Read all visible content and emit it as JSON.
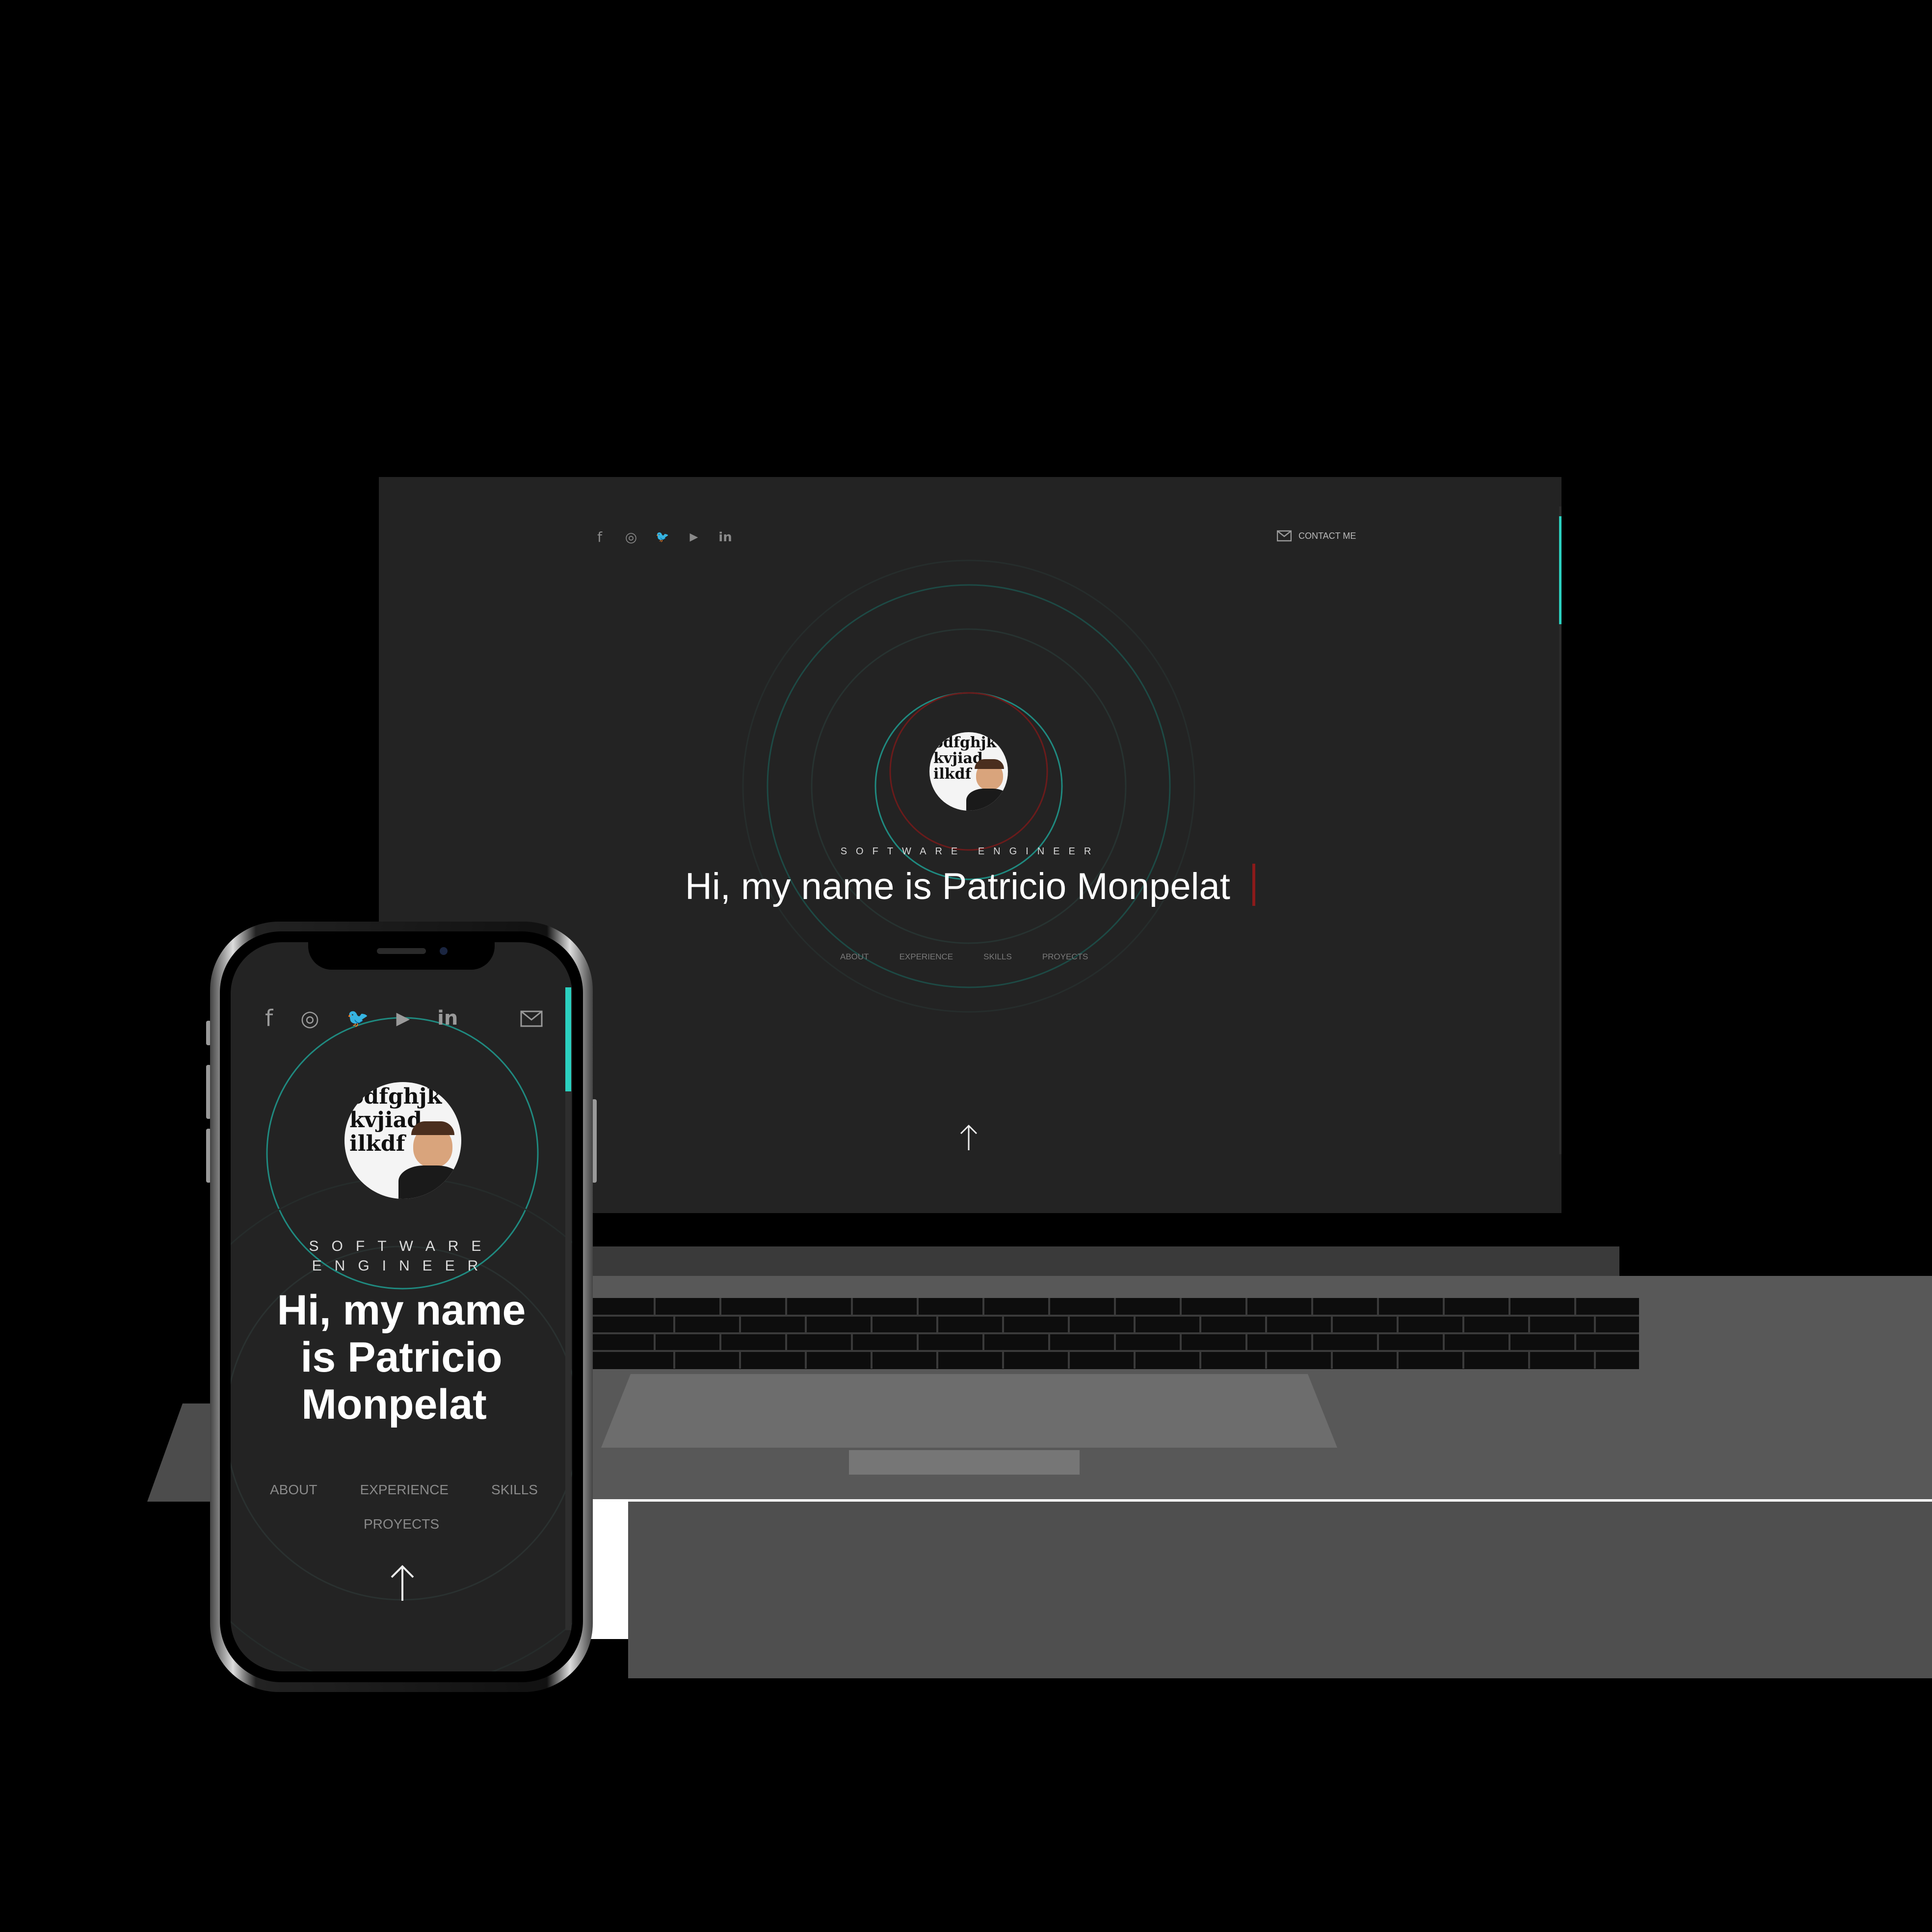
{
  "desktop": {
    "social_icons": [
      "facebook-icon",
      "instagram-icon",
      "twitter-icon",
      "youtube-icon",
      "linkedin-icon"
    ],
    "social_glyphs": [
      "f",
      "◎",
      "🐦",
      "▶",
      "in"
    ],
    "contact_label": "CONTACT ME",
    "subtitle": "SOFTWARE ENGINEER",
    "headline": "Hi, my name is Patricio Monpelat",
    "nav": [
      "ABOUT",
      "EXPERIENCE",
      "SKILLS",
      "PROYECTS"
    ],
    "cursor_color": "#8b1a1a"
  },
  "mobile": {
    "social_glyphs": [
      "f",
      "◎",
      "🐦",
      "▶",
      "in"
    ],
    "subtitle_line1": "SOFTWARE",
    "subtitle_line2": "ENGINEER",
    "headline_line1": "Hi, my name",
    "headline_line2": "is Patricio",
    "headline_line3": "Monpelat",
    "nav": [
      "ABOUT",
      "EXPERIENCE",
      "SKILLS",
      "PROYECTS"
    ]
  },
  "avatar_text": [
    "odfghjk",
    "kvjiad",
    "ilkdf"
  ],
  "colors": {
    "accent_teal": "#2bd0bf",
    "background": "#232323",
    "accent_red": "#8b1a1a"
  }
}
